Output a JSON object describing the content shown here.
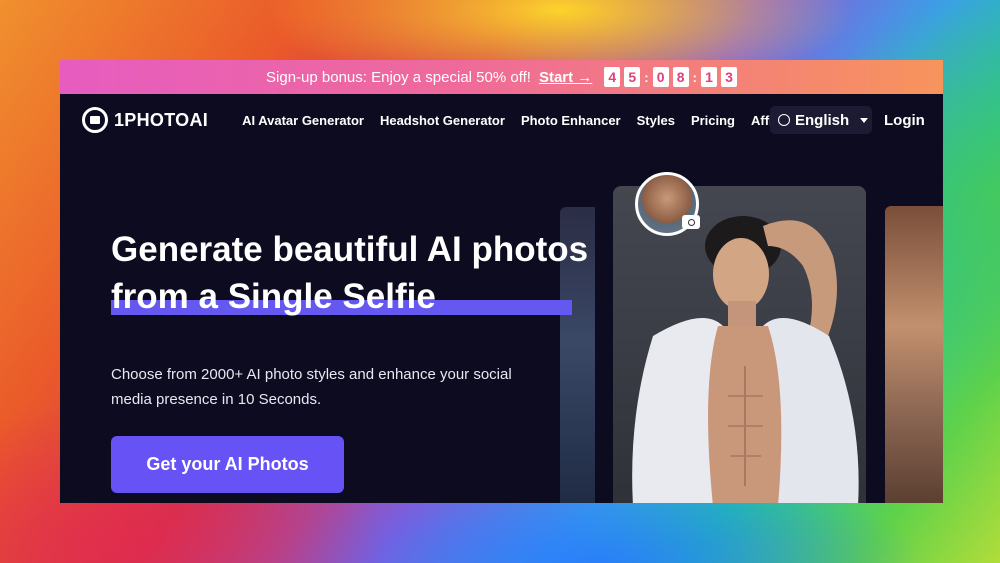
{
  "promo": {
    "text": "Sign-up bonus: Enjoy a special 50% off!",
    "start_label": "Start →",
    "countdown": [
      "4",
      "5",
      "0",
      "8",
      "1",
      "3"
    ]
  },
  "nav": {
    "logo": "1PHOTOAI",
    "links": [
      "AI Avatar Generator",
      "Headshot Generator",
      "Photo Enhancer",
      "Styles",
      "Pricing",
      "Affiliates"
    ],
    "language": "English",
    "login": "Login"
  },
  "hero": {
    "title_line1": "Generate beautiful AI photos",
    "title_line2": "from a Single Selfie",
    "subtitle": "Choose from 2000+ AI photo styles and enhance your social media presence in 10 Seconds.",
    "cta": "Get your AI Photos"
  },
  "colors": {
    "accent": "#6652f5",
    "underline": "#6458f0",
    "promo_start": "#e65cc0",
    "promo_end": "#f7945c",
    "page_bg": "#0c0b1f"
  },
  "icons": [
    "logo-badge-icon",
    "globe-icon",
    "caret-down-icon",
    "camera-icon"
  ]
}
